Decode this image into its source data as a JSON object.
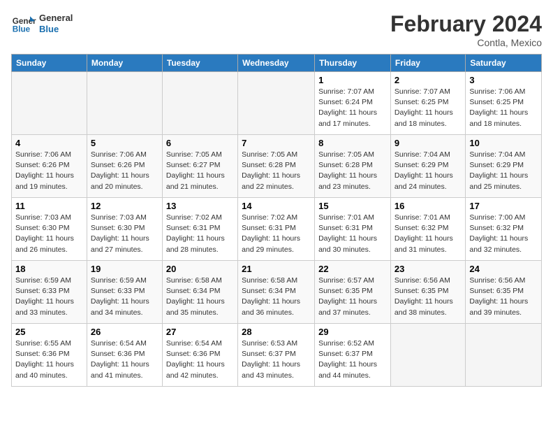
{
  "header": {
    "logo_general": "General",
    "logo_blue": "Blue",
    "title": "February 2024",
    "subtitle": "Contla, Mexico"
  },
  "columns": [
    "Sunday",
    "Monday",
    "Tuesday",
    "Wednesday",
    "Thursday",
    "Friday",
    "Saturday"
  ],
  "weeks": [
    [
      {
        "day": "",
        "info": ""
      },
      {
        "day": "",
        "info": ""
      },
      {
        "day": "",
        "info": ""
      },
      {
        "day": "",
        "info": ""
      },
      {
        "day": "1",
        "info": "Sunrise: 7:07 AM\nSunset: 6:24 PM\nDaylight: 11 hours and 17 minutes."
      },
      {
        "day": "2",
        "info": "Sunrise: 7:07 AM\nSunset: 6:25 PM\nDaylight: 11 hours and 18 minutes."
      },
      {
        "day": "3",
        "info": "Sunrise: 7:06 AM\nSunset: 6:25 PM\nDaylight: 11 hours and 18 minutes."
      }
    ],
    [
      {
        "day": "4",
        "info": "Sunrise: 7:06 AM\nSunset: 6:26 PM\nDaylight: 11 hours and 19 minutes."
      },
      {
        "day": "5",
        "info": "Sunrise: 7:06 AM\nSunset: 6:26 PM\nDaylight: 11 hours and 20 minutes."
      },
      {
        "day": "6",
        "info": "Sunrise: 7:05 AM\nSunset: 6:27 PM\nDaylight: 11 hours and 21 minutes."
      },
      {
        "day": "7",
        "info": "Sunrise: 7:05 AM\nSunset: 6:28 PM\nDaylight: 11 hours and 22 minutes."
      },
      {
        "day": "8",
        "info": "Sunrise: 7:05 AM\nSunset: 6:28 PM\nDaylight: 11 hours and 23 minutes."
      },
      {
        "day": "9",
        "info": "Sunrise: 7:04 AM\nSunset: 6:29 PM\nDaylight: 11 hours and 24 minutes."
      },
      {
        "day": "10",
        "info": "Sunrise: 7:04 AM\nSunset: 6:29 PM\nDaylight: 11 hours and 25 minutes."
      }
    ],
    [
      {
        "day": "11",
        "info": "Sunrise: 7:03 AM\nSunset: 6:30 PM\nDaylight: 11 hours and 26 minutes."
      },
      {
        "day": "12",
        "info": "Sunrise: 7:03 AM\nSunset: 6:30 PM\nDaylight: 11 hours and 27 minutes."
      },
      {
        "day": "13",
        "info": "Sunrise: 7:02 AM\nSunset: 6:31 PM\nDaylight: 11 hours and 28 minutes."
      },
      {
        "day": "14",
        "info": "Sunrise: 7:02 AM\nSunset: 6:31 PM\nDaylight: 11 hours and 29 minutes."
      },
      {
        "day": "15",
        "info": "Sunrise: 7:01 AM\nSunset: 6:31 PM\nDaylight: 11 hours and 30 minutes."
      },
      {
        "day": "16",
        "info": "Sunrise: 7:01 AM\nSunset: 6:32 PM\nDaylight: 11 hours and 31 minutes."
      },
      {
        "day": "17",
        "info": "Sunrise: 7:00 AM\nSunset: 6:32 PM\nDaylight: 11 hours and 32 minutes."
      }
    ],
    [
      {
        "day": "18",
        "info": "Sunrise: 6:59 AM\nSunset: 6:33 PM\nDaylight: 11 hours and 33 minutes."
      },
      {
        "day": "19",
        "info": "Sunrise: 6:59 AM\nSunset: 6:33 PM\nDaylight: 11 hours and 34 minutes."
      },
      {
        "day": "20",
        "info": "Sunrise: 6:58 AM\nSunset: 6:34 PM\nDaylight: 11 hours and 35 minutes."
      },
      {
        "day": "21",
        "info": "Sunrise: 6:58 AM\nSunset: 6:34 PM\nDaylight: 11 hours and 36 minutes."
      },
      {
        "day": "22",
        "info": "Sunrise: 6:57 AM\nSunset: 6:35 PM\nDaylight: 11 hours and 37 minutes."
      },
      {
        "day": "23",
        "info": "Sunrise: 6:56 AM\nSunset: 6:35 PM\nDaylight: 11 hours and 38 minutes."
      },
      {
        "day": "24",
        "info": "Sunrise: 6:56 AM\nSunset: 6:35 PM\nDaylight: 11 hours and 39 minutes."
      }
    ],
    [
      {
        "day": "25",
        "info": "Sunrise: 6:55 AM\nSunset: 6:36 PM\nDaylight: 11 hours and 40 minutes."
      },
      {
        "day": "26",
        "info": "Sunrise: 6:54 AM\nSunset: 6:36 PM\nDaylight: 11 hours and 41 minutes."
      },
      {
        "day": "27",
        "info": "Sunrise: 6:54 AM\nSunset: 6:36 PM\nDaylight: 11 hours and 42 minutes."
      },
      {
        "day": "28",
        "info": "Sunrise: 6:53 AM\nSunset: 6:37 PM\nDaylight: 11 hours and 43 minutes."
      },
      {
        "day": "29",
        "info": "Sunrise: 6:52 AM\nSunset: 6:37 PM\nDaylight: 11 hours and 44 minutes."
      },
      {
        "day": "",
        "info": ""
      },
      {
        "day": "",
        "info": ""
      }
    ]
  ]
}
